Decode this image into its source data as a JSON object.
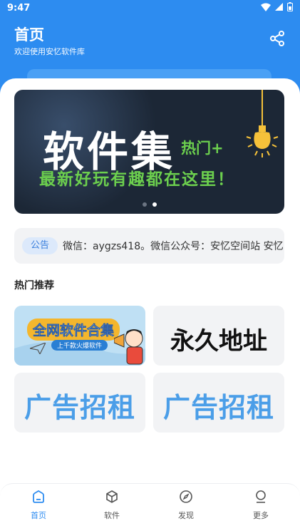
{
  "status": {
    "time": "9:47"
  },
  "header": {
    "title": "首页",
    "subtitle": "欢迎使用安忆软件库"
  },
  "banner": {
    "title": "软件集",
    "hot": "热门+",
    "slogan": "最新好玩有趣都在这里！",
    "slide_count": 2,
    "active_slide": 2
  },
  "notice": {
    "tag": "公告",
    "text": "微信：aygzs418。微信公众号：安忆空间站  安忆"
  },
  "section": {
    "title": "热门推荐"
  },
  "grid": {
    "collection_title": "全网软件合集",
    "collection_sub": "上千款火爆软件",
    "permanent": "永久地址",
    "ad1": "广告招租",
    "ad2": "广告招租"
  },
  "tabs": [
    {
      "label": "首页",
      "icon": "home-icon"
    },
    {
      "label": "软件",
      "icon": "box-icon"
    },
    {
      "label": "发现",
      "icon": "compass-icon"
    },
    {
      "label": "更多",
      "icon": "user-icon"
    }
  ],
  "colors": {
    "primary": "#2d8cf0",
    "banner_bg": "#1c2736",
    "banner_green": "#6ccf4e",
    "ad_blue": "#4b9ee8"
  }
}
